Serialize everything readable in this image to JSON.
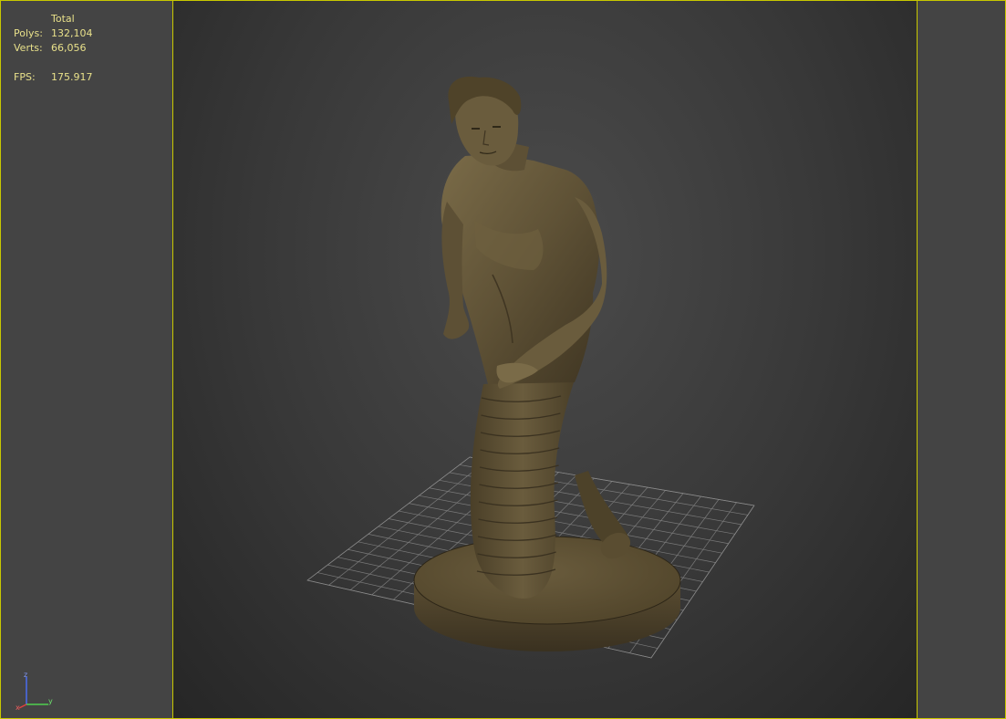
{
  "stats": {
    "header": "Total",
    "polys_label": "Polys:",
    "polys_value": "132,104",
    "verts_label": "Verts:",
    "verts_value": "66,056",
    "fps_label": "FPS:",
    "fps_value": "175.917"
  },
  "gizmo": {
    "z_label": "z",
    "y_label": "y",
    "x_label": "x"
  },
  "colors": {
    "frame": "#c8c800",
    "stats_text": "#e8e08a",
    "statue": "#5f5236",
    "statue_shadow": "#3f3522",
    "grid": "#9a9a9a"
  },
  "scene": {
    "model": "naga-statue",
    "base": "round-pedestal",
    "grid": "home-grid"
  }
}
